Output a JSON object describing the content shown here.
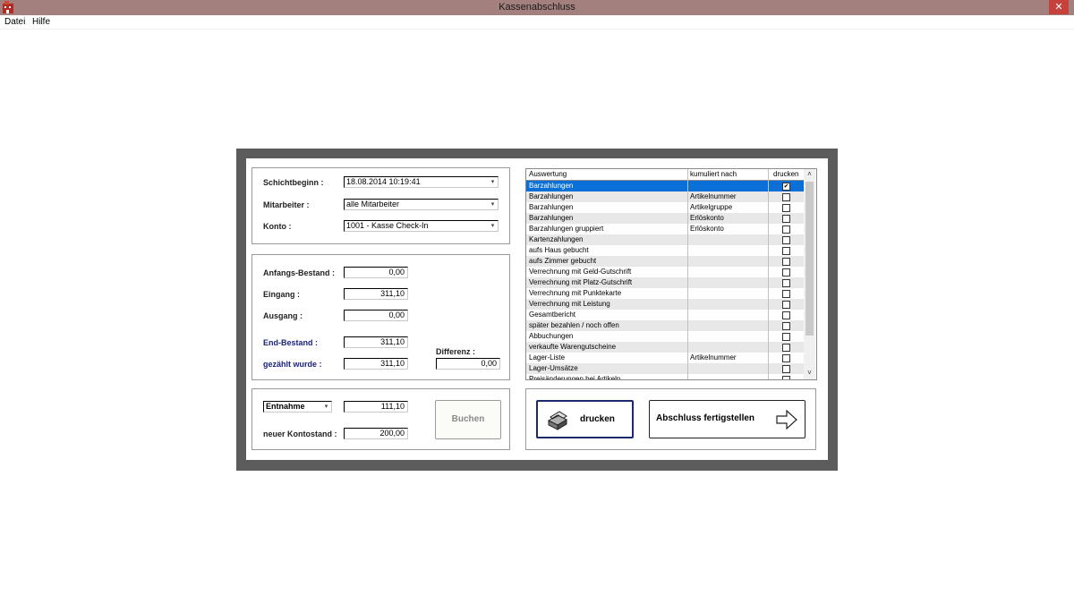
{
  "window": {
    "title": "Kassenabschluss",
    "close_glyph": "✕"
  },
  "menu": {
    "items": [
      "Datei",
      "Hilfe"
    ]
  },
  "shift": {
    "schichtbeginn_label": "Schichtbeginn :",
    "schichtbeginn_value": "18.08.2014 10:19:41",
    "mitarbeiter_label": "Mitarbeiter :",
    "mitarbeiter_value": "alle Mitarbeiter",
    "konto_label": "Konto :",
    "konto_value": "1001 - Kasse Check-In"
  },
  "balances": {
    "anfangs_label": "Anfangs-Bestand :",
    "anfangs_value": "0,00",
    "eingang_label": "Eingang :",
    "eingang_value": "311,10",
    "ausgang_label": "Ausgang :",
    "ausgang_value": "0,00",
    "end_label": "End-Bestand :",
    "end_value": "311,10",
    "gezaehlt_label": "gezählt wurde :",
    "gezaehlt_value": "311,10",
    "differenz_label": "Differenz :",
    "differenz_value": "0,00"
  },
  "booking": {
    "type_value": "Entnahme",
    "amount_value": "111,10",
    "neuer_label": "neuer Kontostand :",
    "neuer_value": "200,00",
    "buchen_label": "Buchen"
  },
  "report_list": {
    "headers": [
      "Auswertung",
      "kumuliert nach",
      "drucken"
    ],
    "rows": [
      {
        "name": "Barzahlungen",
        "cumulated": "",
        "checked": "✔"
      },
      {
        "name": "Barzahlungen",
        "cumulated": "Artikelnummer",
        "checked": ""
      },
      {
        "name": "Barzahlungen",
        "cumulated": "Artikelgruppe",
        "checked": ""
      },
      {
        "name": "Barzahlungen",
        "cumulated": "Erlöskonto",
        "checked": ""
      },
      {
        "name": "Barzahlungen gruppiert",
        "cumulated": "Erlöskonto",
        "checked": ""
      },
      {
        "name": "Kartenzahlungen",
        "cumulated": "",
        "checked": ""
      },
      {
        "name": "aufs Haus gebucht",
        "cumulated": "",
        "checked": ""
      },
      {
        "name": "aufs Zimmer gebucht",
        "cumulated": "",
        "checked": ""
      },
      {
        "name": "Verrechnung mit Geld-Gutschrift",
        "cumulated": "",
        "checked": ""
      },
      {
        "name": "Verrechnung mit Platz-Gutschrift",
        "cumulated": "",
        "checked": ""
      },
      {
        "name": "Verrechnung mit Punktekarte",
        "cumulated": "",
        "checked": ""
      },
      {
        "name": "Verrechnung mit Leistung",
        "cumulated": "",
        "checked": ""
      },
      {
        "name": "Gesamtbericht",
        "cumulated": "",
        "checked": ""
      },
      {
        "name": "später bezahlen / noch offen",
        "cumulated": "",
        "checked": ""
      },
      {
        "name": "Abbuchungen",
        "cumulated": "",
        "checked": ""
      },
      {
        "name": "verkaufte Warengutscheine",
        "cumulated": "",
        "checked": ""
      },
      {
        "name": "Lager-Liste",
        "cumulated": "Artikelnummer",
        "checked": ""
      },
      {
        "name": "Lager-Umsätze",
        "cumulated": "",
        "checked": ""
      },
      {
        "name": "Preisänderungen bei Artikeln",
        "cumulated": "",
        "checked": ""
      }
    ]
  },
  "actions": {
    "drucken_label": "drucken",
    "abschluss_label": "Abschluss fertigstellen"
  },
  "colors": {
    "titlebar": "#a3807d",
    "frame": "#5c5c5c",
    "selection": "#0a6fd6",
    "row_alt": "#e8e8e8",
    "label_blue": "#1a237e"
  },
  "icons": {
    "app": "app-building-icon",
    "close": "close-icon",
    "dropdown": "chevron-down-icon",
    "print": "printer-icon",
    "finish": "arrow-right-icon",
    "scroll_up": "scroll-up-icon",
    "scroll_down": "scroll-down-icon"
  }
}
